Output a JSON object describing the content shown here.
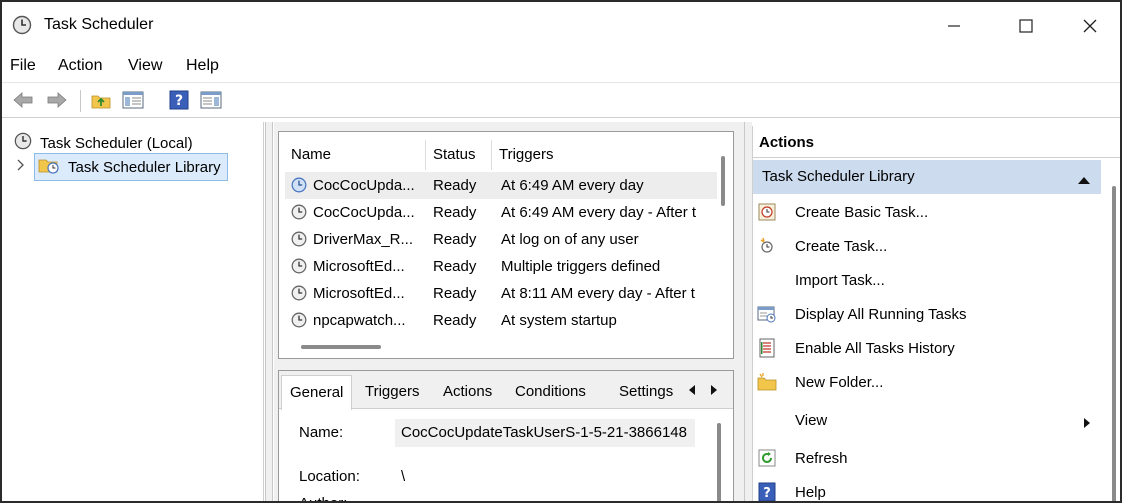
{
  "window": {
    "title": "Task Scheduler",
    "controls": {
      "minimize": "minimize",
      "maximize": "maximize",
      "close": "close"
    }
  },
  "menu": {
    "items": [
      "File",
      "Action",
      "View",
      "Help"
    ]
  },
  "toolbar": {
    "icons": [
      "back-arrow-icon",
      "forward-arrow-icon",
      "up-folder-icon",
      "show-hide-console-tree-icon",
      "help-icon",
      "show-hide-action-pane-icon"
    ]
  },
  "tree": {
    "root": "Task Scheduler (Local)",
    "library": "Task Scheduler Library"
  },
  "tasks": {
    "columns": [
      "Name",
      "Status",
      "Triggers"
    ],
    "rows": [
      {
        "name": "CocCocUpda...",
        "status": "Ready",
        "triggers": "At 6:49 AM every day"
      },
      {
        "name": "CocCocUpda...",
        "status": "Ready",
        "triggers": "At 6:49 AM every day - After t"
      },
      {
        "name": "DriverMax_R...",
        "status": "Ready",
        "triggers": "At log on of any user"
      },
      {
        "name": "MicrosoftEd...",
        "status": "Ready",
        "triggers": "Multiple triggers defined"
      },
      {
        "name": "MicrosoftEd...",
        "status": "Ready",
        "triggers": "At 8:11 AM every day - After t"
      },
      {
        "name": "npcapwatch...",
        "status": "Ready",
        "triggers": "At system startup"
      }
    ]
  },
  "details": {
    "tabs": [
      "General",
      "Triggers",
      "Actions",
      "Conditions",
      "Settings"
    ],
    "name_label": "Name:",
    "name_value": "CocCocUpdateTaskUserS-1-5-21-3866148",
    "location_label": "Location:",
    "location_value": "\\",
    "author_label": "Author:"
  },
  "actions": {
    "title": "Actions",
    "group": "Task Scheduler Library",
    "items": [
      {
        "label": "Create Basic Task...",
        "icon": "create-basic-task-icon"
      },
      {
        "label": "Create Task...",
        "icon": "create-task-icon"
      },
      {
        "label": "Import Task...",
        "icon": ""
      },
      {
        "label": "Display All Running Tasks",
        "icon": "running-tasks-icon"
      },
      {
        "label": "Enable All Tasks History",
        "icon": "tasks-history-icon"
      },
      {
        "label": "New Folder...",
        "icon": "new-folder-icon"
      },
      {
        "label": "View",
        "icon": ""
      },
      {
        "label": "Refresh",
        "icon": "refresh-icon"
      },
      {
        "label": "Help",
        "icon": "help-icon"
      }
    ]
  },
  "colors": {
    "selection_bg": "#dcebfb",
    "group_header_bg": "#ccdcee",
    "border": "#9a9a9a"
  }
}
